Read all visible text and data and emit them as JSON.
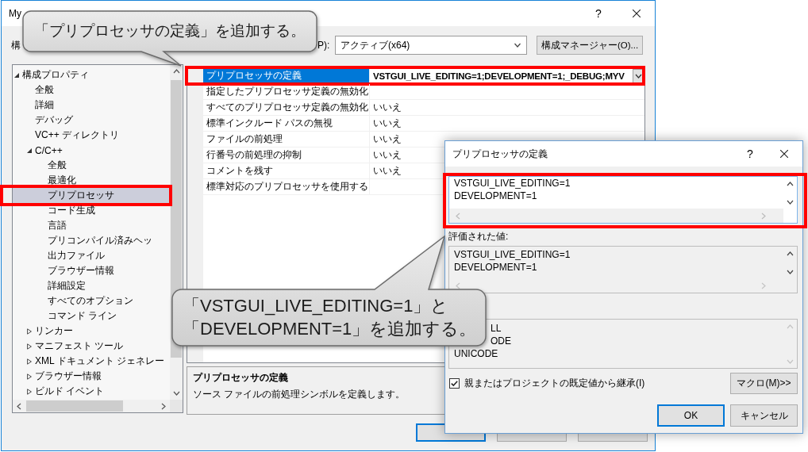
{
  "window": {
    "title": "My",
    "help": "?"
  },
  "config_bar": {
    "config_label": "構",
    "platform_label": "P):",
    "platform_value": "アクティブ(x64)",
    "manager_button": "構成マネージャー(O)..."
  },
  "tree": {
    "items": [
      {
        "label": "構成プロパティ",
        "kind": "group",
        "expanded": true,
        "selected": false,
        "highlighted": false,
        "children": [
          {
            "label": "全般",
            "kind": "page",
            "selected": false,
            "highlighted": false
          },
          {
            "label": "詳細",
            "kind": "page",
            "selected": false,
            "highlighted": false
          },
          {
            "label": "デバッグ",
            "kind": "page",
            "selected": false,
            "highlighted": false
          },
          {
            "label": "VC++ ディレクトリ",
            "kind": "page",
            "selected": false,
            "highlighted": false
          },
          {
            "label": "C/C++",
            "kind": "group",
            "expanded": true,
            "selected": false,
            "highlighted": false,
            "children": [
              {
                "label": "全般",
                "kind": "page",
                "selected": false,
                "highlighted": false
              },
              {
                "label": "最適化",
                "kind": "page",
                "selected": false,
                "highlighted": false
              },
              {
                "label": "プリプロセッサ",
                "kind": "page",
                "selected": true,
                "highlighted": true
              },
              {
                "label": "コード生成",
                "kind": "page",
                "selected": false,
                "highlighted": false
              },
              {
                "label": "言語",
                "kind": "page",
                "selected": false,
                "highlighted": false
              },
              {
                "label": "プリコンパイル済みヘッ",
                "kind": "page",
                "selected": false,
                "highlighted": false
              },
              {
                "label": "出力ファイル",
                "kind": "page",
                "selected": false,
                "highlighted": false
              },
              {
                "label": "ブラウザー情報",
                "kind": "page",
                "selected": false,
                "highlighted": false
              },
              {
                "label": "詳細設定",
                "kind": "page",
                "selected": false,
                "highlighted": false
              },
              {
                "label": "すべてのオプション",
                "kind": "page",
                "selected": false,
                "highlighted": false
              },
              {
                "label": "コマンド ライン",
                "kind": "page",
                "selected": false,
                "highlighted": false
              }
            ]
          },
          {
            "label": "リンカー",
            "kind": "group",
            "expanded": false,
            "selected": false,
            "highlighted": false
          },
          {
            "label": "マニフェスト ツール",
            "kind": "group",
            "expanded": false,
            "selected": false,
            "highlighted": false
          },
          {
            "label": "XML ドキュメント ジェネレー",
            "kind": "group",
            "expanded": false,
            "selected": false,
            "highlighted": false
          },
          {
            "label": "ブラウザー情報",
            "kind": "group",
            "expanded": false,
            "selected": false,
            "highlighted": false
          },
          {
            "label": "ビルド イベント",
            "kind": "group",
            "expanded": false,
            "selected": false,
            "highlighted": false
          }
        ]
      }
    ]
  },
  "grid": {
    "rows": [
      {
        "name": "プリプロセッサの定義",
        "value": "VSTGUI_LIVE_EDITING=1;DEVELOPMENT=1;_DEBUG;MYV",
        "selected": true,
        "modified": true,
        "highlighted": true
      },
      {
        "name": "指定したプリプロセッサ定義の無効化",
        "selected": false,
        "highlighted": false
      },
      {
        "name": "すべてのプリプロセッサ定義の無効化",
        "value": "いいえ",
        "selected": false,
        "modified": false,
        "highlighted": false
      },
      {
        "name": "標準インクルード パスの無視",
        "value": "いいえ",
        "selected": false,
        "modified": false,
        "highlighted": false
      },
      {
        "name": "ファイルの前処理",
        "value": "いいえ",
        "selected": false,
        "modified": false,
        "highlighted": false
      },
      {
        "name": "行番号の前処理の抑制",
        "value": "いいえ",
        "selected": false,
        "modified": false,
        "highlighted": false
      },
      {
        "name": "コメントを残す",
        "value": "いいえ",
        "selected": false,
        "modified": false,
        "highlighted": false
      },
      {
        "name": "標準対応のプリプロセッサを使用する",
        "selected": false,
        "highlighted": false
      }
    ]
  },
  "description": {
    "title": "プリプロセッサの定義",
    "text": "ソース ファイルの前処理シンボルを定義します。"
  },
  "footer_buttons": [
    {
      "default": true
    },
    {
      "default": false
    },
    {
      "default": false
    }
  ],
  "dialog": {
    "title": "プリプロセッサの定義",
    "help": "?",
    "definitions": {
      "lines": [
        "VSTGUI_LIVE_EDITING=1",
        "DEVELOPMENT=1"
      ],
      "highlighted": true
    },
    "evaluated": {
      "label": "評価された値:",
      "lines": [
        "VSTGUI_LIVE_EDITING=1",
        "DEVELOPMENT=1"
      ]
    },
    "inherited": {
      "lines": [
        "LL",
        "ODE",
        "UNICODE"
      ]
    },
    "inherit": {
      "label": "親またはプロジェクトの既定値から継承(I)",
      "checked": true
    },
    "macro_button": "マクロ(M)>>",
    "buttons": [
      {
        "label": "OK",
        "default": true
      },
      {
        "label": "キャンセル",
        "default": false
      }
    ]
  },
  "callouts": [
    {
      "lines": [
        "「プリプロセッサの定義」を追加する。"
      ]
    },
    {
      "lines": [
        "「VSTGUI_LIVE_EDITING=1」と",
        "「DEVELOPMENT=1」を追加する。"
      ]
    }
  ]
}
